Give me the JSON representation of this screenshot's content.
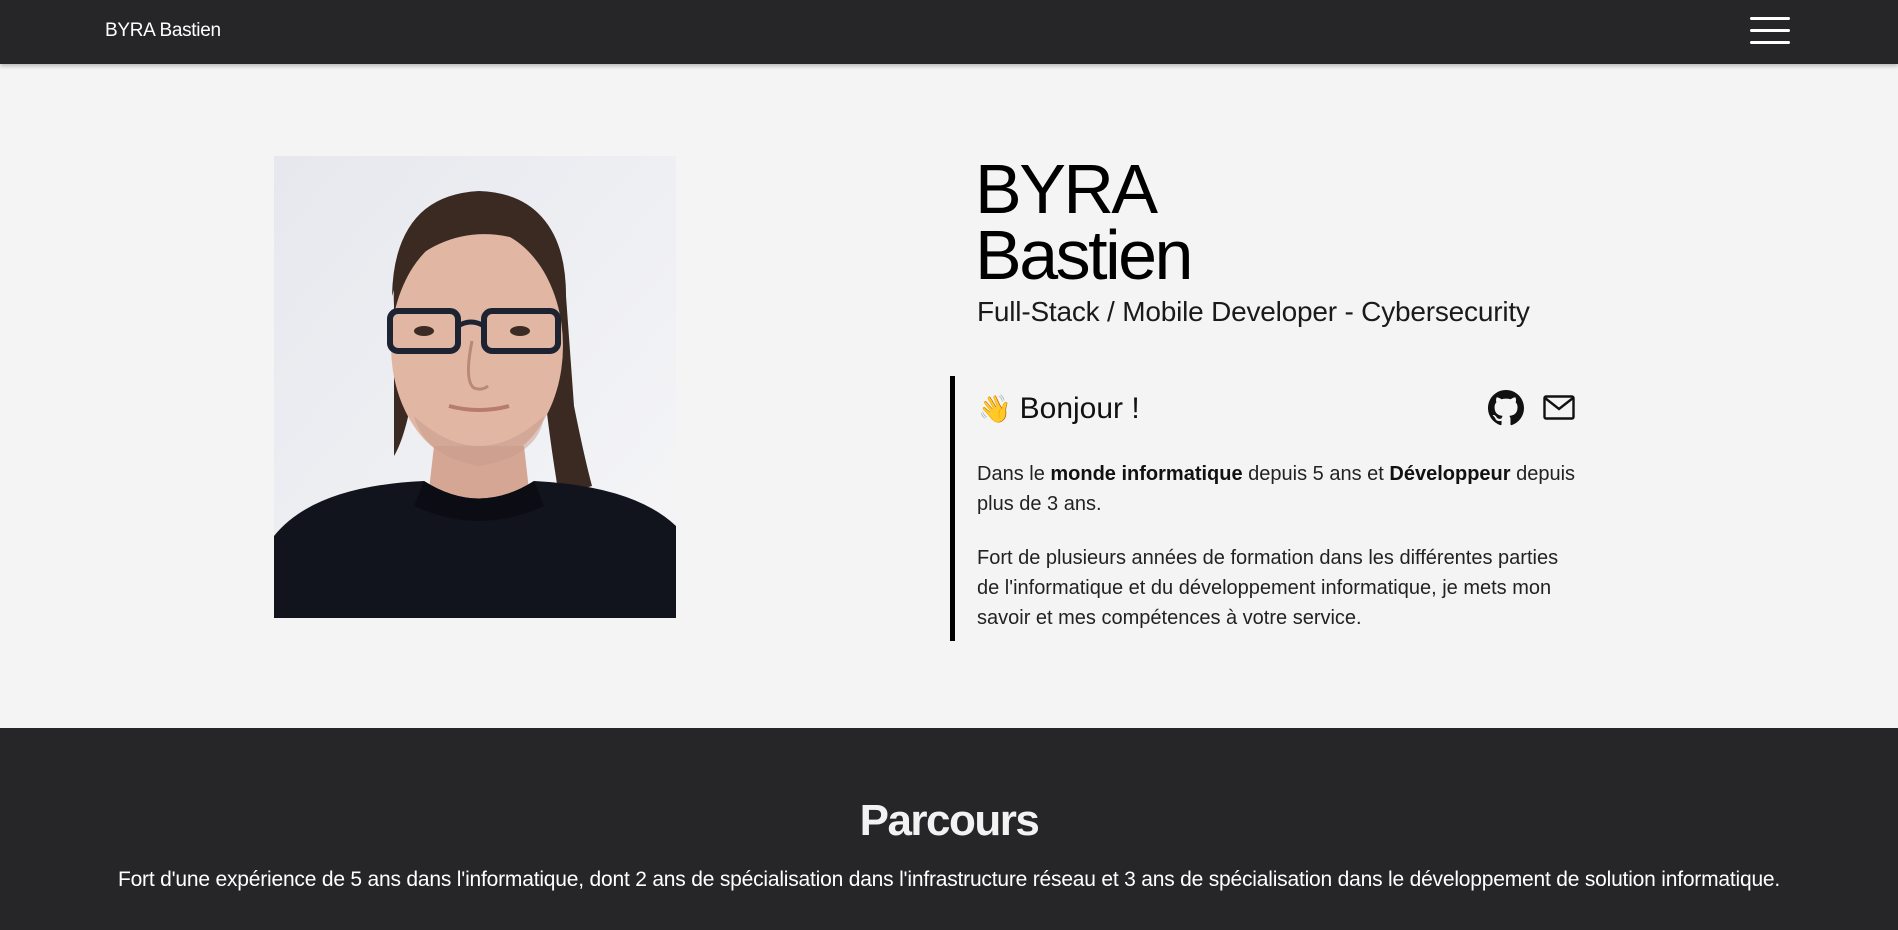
{
  "nav": {
    "brand": "BYRA Bastien",
    "menu_icon": "hamburger-menu-icon"
  },
  "hero": {
    "name_line1": "BYRA",
    "name_line2": "Bastien",
    "subtitle": "Full-Stack / Mobile Developer - Cybersecurity",
    "photo_icon": "profile-photo"
  },
  "about": {
    "wave_emoji": "👋",
    "greeting": "Bonjour !",
    "github_icon": "github-icon",
    "mail_icon": "mail-icon",
    "p1": {
      "t1": "Dans le ",
      "b1": "monde informatique",
      "t2": " depuis 5 ans et ",
      "b2": "Développeur",
      "t3": " depuis plus de 3 ans."
    },
    "p2": "Fort de plusieurs années de formation dans les différentes parties de l'informatique et du développement informatique, je mets mon savoir et mes compétences à votre service."
  },
  "parcours": {
    "title": "Parcours",
    "text": "Fort d'une expérience de 5 ans dans l'informatique, dont 2 ans de spécialisation dans l'infrastructure réseau et 3 ans de spécialisation dans le développement de solution informatique."
  },
  "colors": {
    "nav_bg": "#262628",
    "page_bg": "#f4f4f4",
    "accent": "#000000"
  }
}
